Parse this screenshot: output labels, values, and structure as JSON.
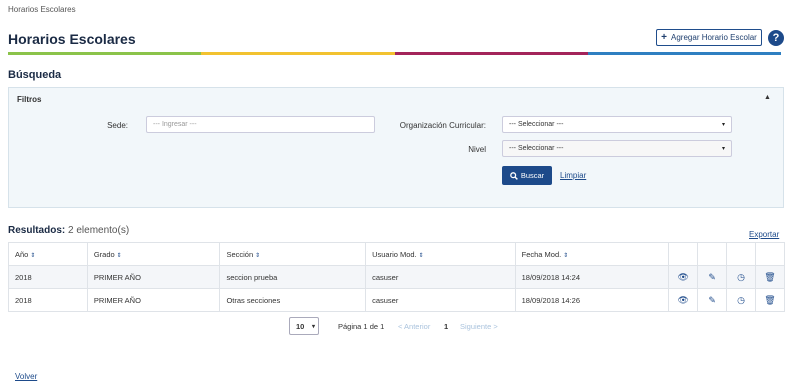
{
  "breadcrumb": "Horarios Escolares",
  "page_title": "Horarios Escolares",
  "header": {
    "add_label": "Agregar Horario Escolar",
    "help_symbol": "?"
  },
  "colors": {
    "bar": [
      "#8bc34a",
      "#f2c230",
      "#a3245a",
      "#2e7fc1"
    ],
    "primary": "#1d4a8a"
  },
  "search": {
    "title": "Búsqueda",
    "filters_label": "Filtros",
    "sede_label": "Sede:",
    "sede_placeholder": "--- Ingresar ---",
    "org_label": "Organización Curricular:",
    "org_value": "--- Seleccionar ---",
    "nivel_label": "Nivel",
    "nivel_value": "--- Seleccionar ---",
    "search_label": "Buscar",
    "clear_label": "Limpiar"
  },
  "results": {
    "title": "Resultados:",
    "count": "2 elemento(s)",
    "export_label": "Exportar",
    "columns": [
      "Año",
      "Grado",
      "Sección",
      "Usuario Mod.",
      "Fecha Mod."
    ],
    "rows": [
      [
        "2018",
        "PRIMER AÑO",
        "seccion prueba",
        "casuser",
        "18/09/2018 14:24"
      ],
      [
        "2018",
        "PRIMER AÑO",
        "Otras secciones",
        "casuser",
        "18/09/2018 14:26"
      ]
    ]
  },
  "pagination": {
    "page_size": "10",
    "page_info": "Página 1 de 1",
    "prev_label": "< Anterior",
    "current_page": "1",
    "next_label": "Siguiente >"
  },
  "footer": {
    "back_label": "Volver"
  }
}
